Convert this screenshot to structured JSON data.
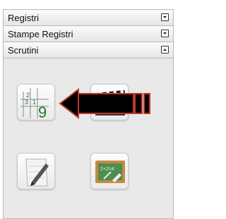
{
  "sections": [
    {
      "label": "Registri",
      "state": "collapsed"
    },
    {
      "label": "Stampe Registri",
      "state": "collapsed"
    },
    {
      "label": "Scrutini",
      "state": "expanded"
    }
  ],
  "scrutini_tiles": [
    {
      "icon": "grid-nine-icon",
      "numbers": [
        "2",
        "3",
        "1",
        "9"
      ]
    },
    {
      "icon": "clapperboard-icon"
    },
    {
      "icon": "pencil-paper-icon"
    },
    {
      "icon": "chalkboard-icon",
      "text": "2+2=4"
    }
  ],
  "colors": {
    "panel_bg": "#e9e9e9",
    "header_bg": "#f1f1f1",
    "border": "#b9b9b9",
    "grid_digit": "#1a7a2c",
    "annotation_arrow": "#c0392b"
  }
}
